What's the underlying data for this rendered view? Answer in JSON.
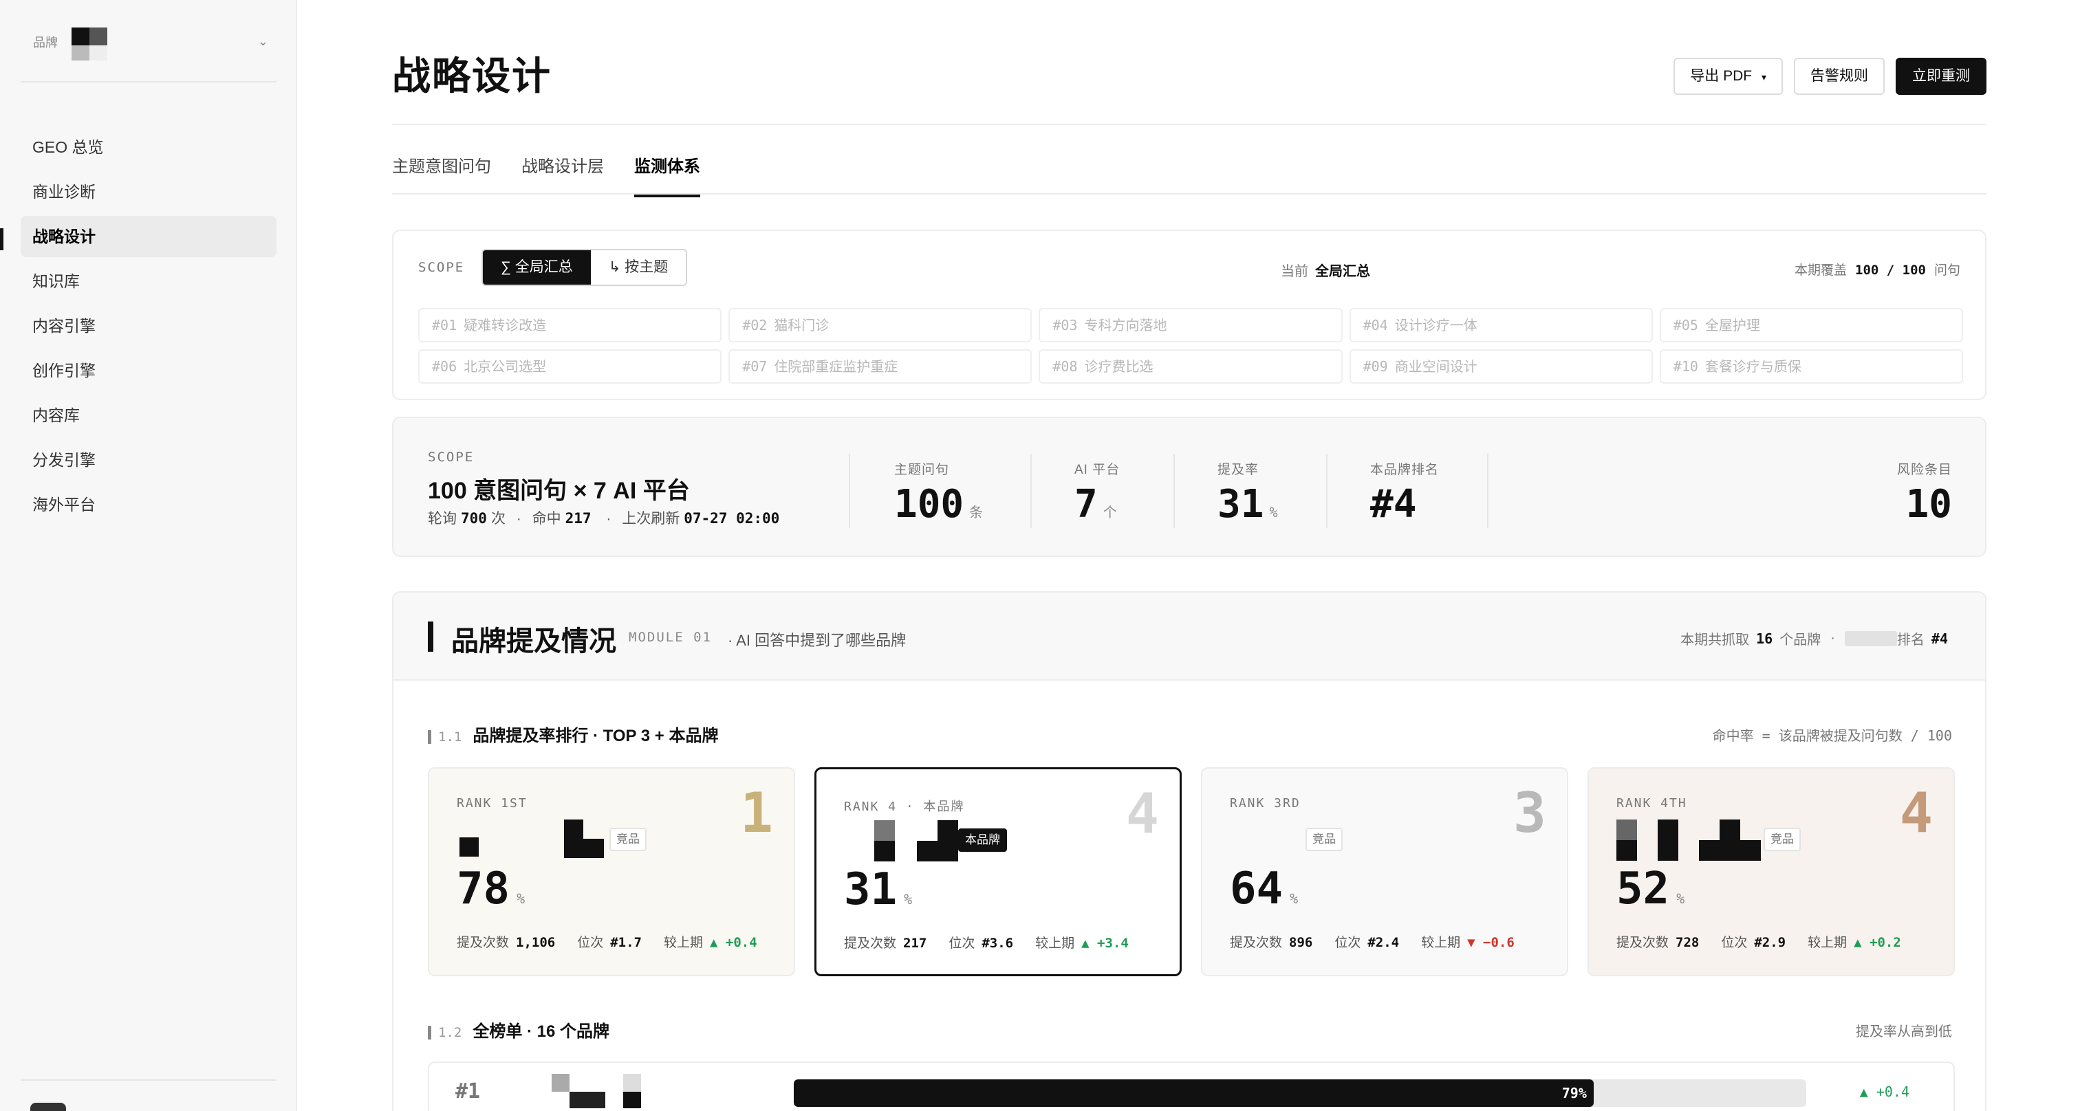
{
  "sidebar": {
    "brand_label": "品牌",
    "brand_caret": "⌄",
    "items": [
      {
        "label": "GEO 总览"
      },
      {
        "label": "商业诊断"
      },
      {
        "label": "战略设计"
      },
      {
        "label": "知识库"
      },
      {
        "label": "内容引擎"
      },
      {
        "label": "创作引擎"
      },
      {
        "label": "内容库"
      },
      {
        "label": "分发引擎"
      },
      {
        "label": "海外平台"
      }
    ],
    "active_index": 2
  },
  "header": {
    "title": "战略设计",
    "export_label": "导出 PDF",
    "export_caret": "▾",
    "alert_label": "告警规则",
    "remeasure_label": "立即重测"
  },
  "tabs": [
    {
      "label": "主题意图问句"
    },
    {
      "label": "战略设计层"
    },
    {
      "label": "监测体系"
    }
  ],
  "scope": {
    "label": "SCOPE",
    "seg_all": "∑ 全局汇总",
    "seg_topic": "↳ 按主题",
    "current_label": "当前",
    "current_value": "全局汇总",
    "coverage_label": "本期覆盖",
    "coverage_value": "100 / 100",
    "coverage_unit": "问句",
    "topics": [
      {
        "num": "#01",
        "name": "疑难转诊改造"
      },
      {
        "num": "#02",
        "name": "猫科门诊"
      },
      {
        "num": "#03",
        "name": "专科方向落地"
      },
      {
        "num": "#04",
        "name": "设计诊疗一体"
      },
      {
        "num": "#05",
        "name": "全屋护理"
      },
      {
        "num": "#06",
        "name": "北京公司选型"
      },
      {
        "num": "#07",
        "name": "住院部重症监护重症"
      },
      {
        "num": "#08",
        "name": "诊疗费比选"
      },
      {
        "num": "#09",
        "name": "商业空间设计"
      },
      {
        "num": "#10",
        "name": "套餐诊疗与质保"
      }
    ]
  },
  "summary": {
    "scope_label": "SCOPE",
    "title": "100 意图问句 × 7 AI 平台",
    "poll_label": "轮询",
    "poll_value": "700",
    "poll_unit": "次",
    "sep": "·",
    "hit_label": "命中",
    "hit_value": "217",
    "refresh_label": "上次刷新",
    "refresh_value": "07-27 02:00",
    "stats": [
      {
        "label": "主题问句",
        "value": "100",
        "unit": "条"
      },
      {
        "label": "AI 平台",
        "value": "7",
        "unit": "个"
      },
      {
        "label": "提及率",
        "value": "31",
        "unit": "%"
      },
      {
        "label": "本品牌排名",
        "value": "#4",
        "unit": ""
      }
    ],
    "risk_label": "风险条目",
    "risk_value": "10"
  },
  "module": {
    "title": "品牌提及情况",
    "code": "MODULE 01",
    "desc": "· AI 回答中提到了哪些品牌",
    "meta_prefix": "本期共抓取",
    "meta_count": "16",
    "meta_unit": "个品牌",
    "meta_sep": "·",
    "meta_rank_label": "排名",
    "meta_rank_value": "#4",
    "sec1": {
      "num": "1.1",
      "title": "品牌提及率排行 · TOP 3 + 本品牌",
      "note": "命中率 = 该品牌被提及问句数 / 100"
    },
    "sec2": {
      "num": "1.2",
      "title": "全榜单 · 16 个品牌",
      "note": "提及率从高到低"
    },
    "rank_cards": [
      {
        "tag": "RANK 1ST",
        "big": "1",
        "big_color": "#c9b27a",
        "chip": "竞品",
        "pct": "78",
        "count": "1,106",
        "pos": "#1.7",
        "delta": "▲ +0.4",
        "delta_dir": "up"
      },
      {
        "tag": "RANK 4 · 本品牌",
        "big": "4",
        "big_color": "#d6d6d6",
        "chip": "本品牌",
        "pct": "31",
        "count": "217",
        "pos": "#3.6",
        "delta": "▲ +3.4",
        "delta_dir": "up"
      },
      {
        "tag": "RANK 3RD",
        "big": "3",
        "big_color": "#b9b9b9",
        "chip": "竞品",
        "pct": "64",
        "count": "896",
        "pos": "#2.4",
        "delta": "▼ −0.6",
        "delta_dir": "down"
      },
      {
        "tag": "RANK 4TH",
        "big": "4",
        "big_color": "#c49a7a",
        "chip": "竞品",
        "pct": "52",
        "count": "728",
        "pos": "#2.9",
        "delta": "▲ +0.2",
        "delta_dir": "up"
      }
    ],
    "pct_unit": "%",
    "count_label": "提及次数",
    "pos_label": "位次",
    "delta_label": "较上期",
    "full_rows": [
      {
        "rank": "#1",
        "pct": 79,
        "pct_label": "79%",
        "delta": "▲ +0.4"
      }
    ]
  }
}
